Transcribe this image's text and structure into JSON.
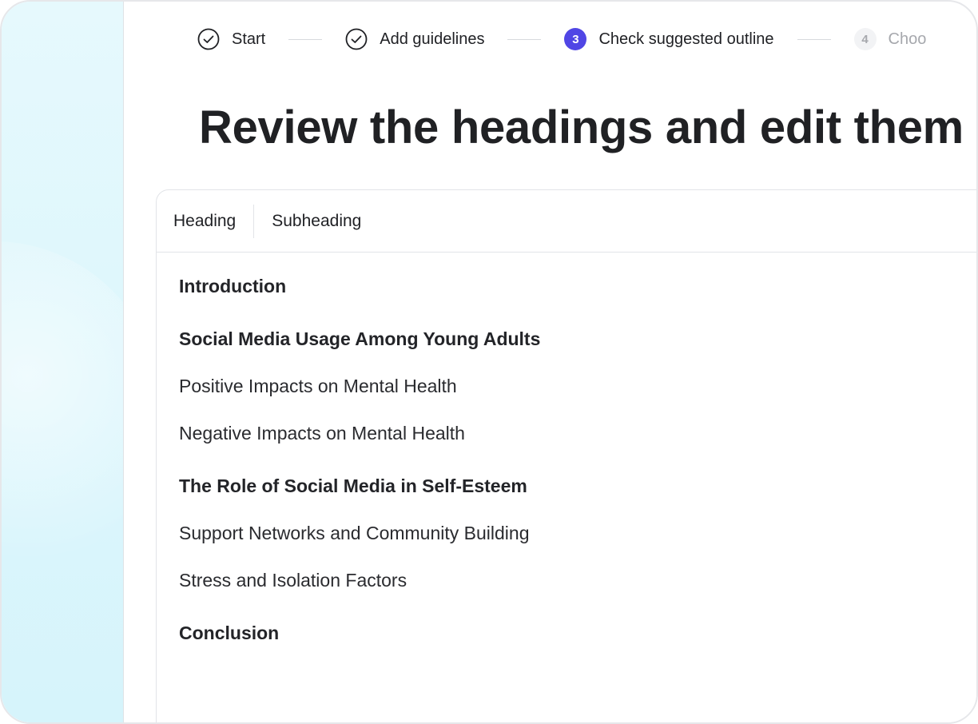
{
  "stepper": {
    "steps": [
      {
        "label": "Start",
        "status": "done",
        "icon": "check-circle-icon"
      },
      {
        "label": "Add guidelines",
        "status": "done",
        "icon": "check-circle-icon"
      },
      {
        "number": "3",
        "label": "Check suggested outline",
        "status": "active"
      },
      {
        "number": "4",
        "label": "Choo",
        "status": "upcoming"
      }
    ]
  },
  "page": {
    "title": "Review the headings and edit them"
  },
  "editor": {
    "toolbar": {
      "heading_label": "Heading",
      "subheading_label": "Subheading"
    },
    "outline": [
      {
        "text": "Introduction",
        "level": "heading"
      },
      {
        "text": "Social Media Usage Among Young Adults",
        "level": "heading"
      },
      {
        "text": "Positive Impacts on Mental Health",
        "level": "subheading"
      },
      {
        "text": "Negative Impacts on Mental Health",
        "level": "subheading"
      },
      {
        "text": "The Role of Social Media in Self-Esteem",
        "level": "heading"
      },
      {
        "text": "Support Networks and Community Building",
        "level": "subheading"
      },
      {
        "text": "Stress and Isolation Factors",
        "level": "subheading"
      },
      {
        "text": "Conclusion",
        "level": "heading"
      }
    ]
  },
  "colors": {
    "accent": "#5046e5",
    "side_panel": "#dcf6fc",
    "text": "#202124",
    "muted": "#a6a8ad"
  }
}
